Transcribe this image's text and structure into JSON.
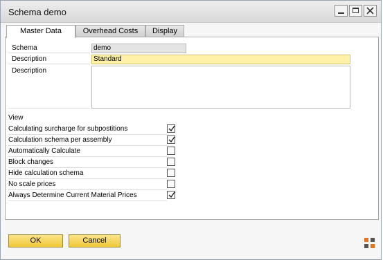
{
  "window": {
    "title": "Schema demo"
  },
  "tabs": [
    {
      "label": "Master Data",
      "active": true
    },
    {
      "label": "Overhead Costs",
      "active": false
    },
    {
      "label": "Display",
      "active": false
    }
  ],
  "form": {
    "schema_label": "Schema",
    "schema_value": "demo",
    "description_label": "Description",
    "description_value": "Standard",
    "description2_label": "Description",
    "description2_value": ""
  },
  "view": {
    "heading": "View",
    "options": [
      {
        "label": "Calculating surcharge for subpostitions",
        "checked": true
      },
      {
        "label": "Calculation schema per assembly",
        "checked": true
      },
      {
        "label": "Automatically Calculate",
        "checked": false
      },
      {
        "label": "Block changes",
        "checked": false
      },
      {
        "label": "Hide calculation schema",
        "checked": false
      },
      {
        "label": "No scale prices",
        "checked": false
      },
      {
        "label": "Always Determine Current Material Prices",
        "checked": true
      }
    ]
  },
  "buttons": {
    "ok_label": "OK",
    "cancel_label": "Cancel"
  },
  "colors": {
    "highlight": "#fff2a8",
    "button": "#f0c838",
    "logo": "#e8731c"
  }
}
